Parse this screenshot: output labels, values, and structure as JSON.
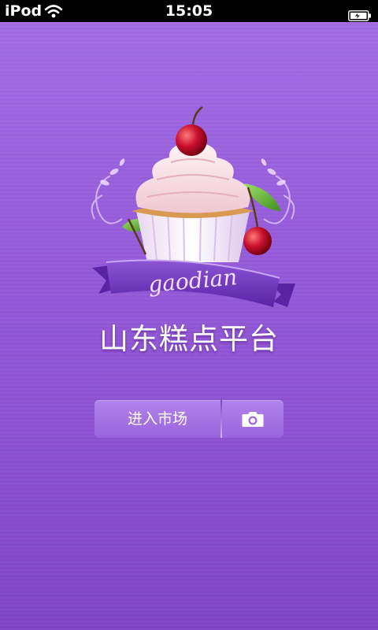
{
  "status_bar": {
    "carrier": "iPod",
    "time": "15:05",
    "icons": [
      "wifi-icon",
      "battery-icon"
    ]
  },
  "splash": {
    "logo_text": "gaodian",
    "title": "山东糕点平台",
    "enter_button_label": "进入市场",
    "camera_icon": "camera-icon"
  },
  "colors": {
    "background_top": "#a06ae2",
    "background_bottom": "#7f44c4",
    "button": "#a675e4",
    "ribbon": "#7a3fc7"
  }
}
